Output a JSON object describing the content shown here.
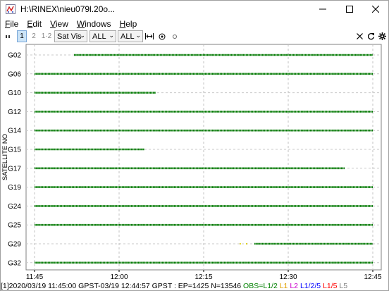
{
  "window": {
    "title": "H:\\RINEX\\nieu079l.20o...",
    "minimize": "—",
    "maximize": "☐",
    "close": "✕"
  },
  "menu": [
    {
      "label": "File",
      "key": "F",
      "rest": "ile"
    },
    {
      "label": "Edit",
      "key": "E",
      "rest": "dit"
    },
    {
      "label": "View",
      "key": "V",
      "rest": "iew"
    },
    {
      "label": "Windows",
      "key": "W",
      "rest": "indows"
    },
    {
      "label": "Help",
      "key": "H",
      "rest": "elp"
    }
  ],
  "toolbar": {
    "btn1": "1",
    "btn2": "2",
    "btn12": "1·2",
    "plot_type": "Sat Vis",
    "filter1": "ALL",
    "filter2": "ALL"
  },
  "chart_data": {
    "type": "scatter",
    "ylabel": "SATELLITE NO",
    "categories": [
      "G02",
      "G06",
      "G10",
      "G12",
      "G14",
      "G15",
      "G17",
      "G19",
      "G24",
      "G25",
      "G29",
      "G32"
    ],
    "x_ticks": [
      "11:45",
      "12:00",
      "12:15",
      "12:30",
      "12:45"
    ],
    "x_tick_minutes": [
      0,
      15,
      30,
      45,
      60
    ],
    "xlim_minutes": [
      -1.5,
      61.5
    ],
    "series": [
      {
        "sat": "G02",
        "start": 7.0,
        "end": 60.0
      },
      {
        "sat": "G06",
        "start": 0.0,
        "end": 60.0
      },
      {
        "sat": "G10",
        "start": 0.0,
        "end": 21.5
      },
      {
        "sat": "G12",
        "start": 0.0,
        "end": 60.0
      },
      {
        "sat": "G14",
        "start": 0.0,
        "end": 60.0
      },
      {
        "sat": "G15",
        "start": 0.0,
        "end": 19.5
      },
      {
        "sat": "G17",
        "start": 0.0,
        "end": 55.0
      },
      {
        "sat": "G19",
        "start": 0.0,
        "end": 60.0
      },
      {
        "sat": "G24",
        "start": 0.0,
        "end": 60.0
      },
      {
        "sat": "G25",
        "start": 0.0,
        "end": 60.0
      },
      {
        "sat": "G29",
        "start": 39.0,
        "end": 60.0,
        "pre_points": [
          36.5,
          37.6
        ]
      },
      {
        "sat": "G32",
        "start": 0.0,
        "end": 60.0
      }
    ],
    "grid": true,
    "line_color": "#007a00",
    "pre_point_color": "#e0d000"
  },
  "status": {
    "info": "[1]2020/03/19 11:45:00 GPST-03/19 12:44:57 GPST : EP=1425 N=13546 ",
    "legend": [
      {
        "text": "OBS=L1/2 ",
        "color": "#008000"
      },
      {
        "text": "L1 ",
        "color": "#e0a000"
      },
      {
        "text": "L2 ",
        "color": "#cc00cc"
      },
      {
        "text": "L1/2/5 ",
        "color": "#0000ff"
      },
      {
        "text": "L1/5 ",
        "color": "#ff0000"
      },
      {
        "text": "L5",
        "color": "#808080"
      }
    ]
  }
}
